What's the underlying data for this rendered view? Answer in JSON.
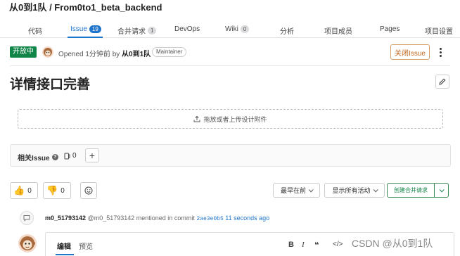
{
  "header": {
    "repo_title": "从0到1队 / From0to1_beta_backend"
  },
  "tabs": [
    {
      "label": "代码"
    },
    {
      "label": "Issue",
      "count": "19"
    },
    {
      "label": "合并请求",
      "count": "1"
    },
    {
      "label": "DevOps"
    },
    {
      "label": "Wiki",
      "count": "0"
    },
    {
      "label": "分析"
    },
    {
      "label": "项目成员"
    },
    {
      "label": "Pages"
    },
    {
      "label": "项目设置"
    }
  ],
  "issue": {
    "status": "开放中",
    "opened_prefix": "Opened 1分钟前 by",
    "author": "从0到1队",
    "author_role": "Maintainer",
    "close_label": "关闭Issue",
    "title": "详情接口完善",
    "upload_text": "拖放或者上传设计附件"
  },
  "related": {
    "label": "相关Issue",
    "count": "0"
  },
  "reactions": {
    "thumbs_up": "0",
    "thumbs_down": "0"
  },
  "toolbar": {
    "sort_label": "最早在前",
    "filter_label": "显示所有活动",
    "create_mr_label": "创建合并请求"
  },
  "activity": {
    "user": "m0_51793142",
    "handle": "@m0_51793142",
    "action": "mentioned in commit",
    "commit": "2ae3e0b5",
    "time": "11 seconds ago"
  },
  "editor": {
    "tab_edit": "编辑",
    "tab_preview": "预览",
    "tools": [
      "B",
      "I",
      "❝",
      "</>"
    ]
  },
  "watermark": "CSDN @从0到1队",
  "colors": {
    "accent": "#1f75cb",
    "open": "#108548",
    "close": "#c2661b"
  }
}
